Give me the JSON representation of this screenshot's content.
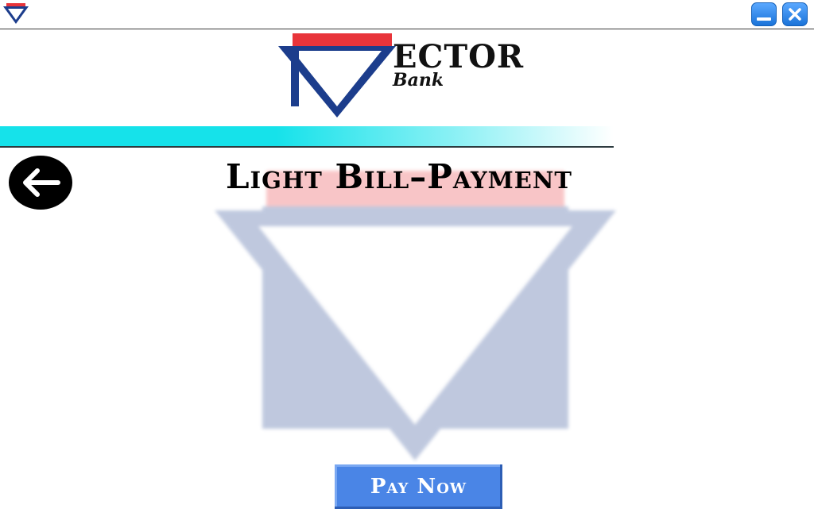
{
  "window": {
    "app_icon": "vector-bank-logo-icon",
    "minimize_icon": "minimize-icon",
    "close_icon": "close-icon"
  },
  "brand": {
    "name": "ECTOR",
    "sub": "Bank",
    "colors": {
      "red": "#e8343a",
      "navy": "#1c3d8c",
      "cyan": "#16e2ea"
    }
  },
  "page": {
    "title": "Light Bill–Payment",
    "back_icon": "arrow-left-icon"
  },
  "actions": {
    "pay_now_label": "Pay Now"
  }
}
